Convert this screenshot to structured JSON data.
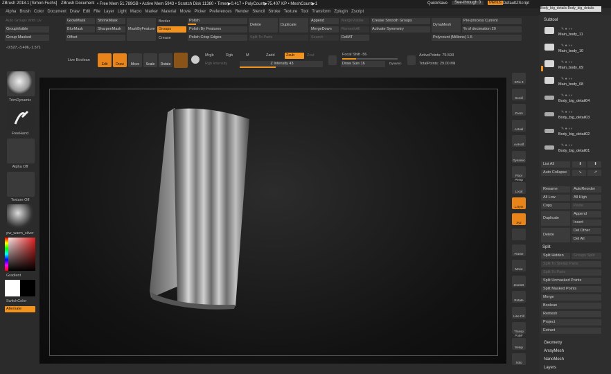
{
  "title": {
    "app": "ZBrush 2018.1 [Simon Fuchs]",
    "doc": "ZBrush Document",
    "stats": "• Free Mem 51.789GB • Active Mem 5943 • Scratch Disk 11380 • Timer▶0.417 • PolyCount▶75.407 KP • MeshCount▶1",
    "quicksave": "QuickSave",
    "seethrough": "See-through  0",
    "menus": "Menus",
    "script": "DefaultZScript"
  },
  "menu": [
    "Alpha",
    "Brush",
    "Color",
    "Document",
    "Draw",
    "Edit",
    "File",
    "Layer",
    "Light",
    "Macro",
    "Marker",
    "Material",
    "Movie",
    "Picker",
    "Preferences",
    "Render",
    "Stencil",
    "Stroke",
    "Texture",
    "Tool",
    "Transform",
    "Zplugin",
    "Zscript"
  ],
  "top_left": {
    "auto_groups": "Auto Groups With Uv",
    "group_visible": "GroupVisible",
    "group_masked": "Group Masked",
    "coords": "-0.527,-3.406,-1.571"
  },
  "masking": {
    "grow": "GrowMask",
    "shrink": "ShrinkMask",
    "blur": "BlurMask",
    "sharpen": "SharpenMask",
    "offset": "Offset",
    "mask_by_feature": "MaskByFeature"
  },
  "polish": {
    "border": "Border",
    "groups": "Groups",
    "crease": "Crease",
    "polish": "Polish",
    "by_features": "Polish By Features",
    "crisp": "Polish Crisp Edges"
  },
  "subtool_ops": {
    "delete": "Delete",
    "duplicate": "Duplicate",
    "append": "Append",
    "merge_down": "MergeDown",
    "merge_visible": "MergeVisible",
    "remesh": "RemeshAll",
    "split_to_parts": "Split To Parts",
    "search": "Search",
    "delmt": "DelMT",
    "crease_smooth": "Crease Smooth Groups",
    "activate_symmetry": "Activate Symmetry",
    "dynamesh": "DynaMesh",
    "preprocess": "Pre-process Current",
    "decimation": "% of decimation 20",
    "polycount_millions": "Polycount (Millions) 1.5"
  },
  "toolbar": {
    "live_boolean": "Live Boolean",
    "edit": "Edit",
    "draw": "Draw",
    "move": "Move",
    "scale": "Scale",
    "rotate": "Rotate",
    "mrgb": "Mrgb",
    "rgb": "Rgb",
    "m": "M",
    "zadd": "Zadd",
    "zsub": "Zsub",
    "zcut": "Zcut",
    "rgb_intensity": "Rgb Intensity",
    "z_intensity": "Z Intensity 43",
    "focal_shift": "Focal Shift -56",
    "draw_size": "Draw Size 16",
    "dynamic": "Dynamic",
    "active_points": "ActivePoints: 75.593",
    "total_points": "TotalPoints: 29.00 Mil"
  },
  "left_shelf": {
    "brush": "TrimDynamic",
    "stroke": "FreeHand",
    "alpha": "Alpha Off",
    "texture": "Texture Off",
    "material": "pw_warm_silver",
    "gradient": "Gradient",
    "switch_color": "SwitchColor",
    "alternate": "Alternate"
  },
  "right_shelf": [
    "SPix 3",
    "Scroll",
    "Zoom",
    "Actual",
    "AAHalf",
    "Dynamic Persp",
    "Floor",
    "Local",
    "L.Sym",
    "Xyz",
    "",
    "Frame",
    "Move",
    "ZoomD",
    "Rotate",
    "Line Fill PolyF",
    "Transp",
    "Setup",
    "Solo"
  ],
  "subtool": {
    "header": "Subtool",
    "tabs": "Body_big_details  Body_big_details",
    "items": [
      "Main_body_11",
      "Main_body_10",
      "Main_body_09",
      "Main_body_08",
      "Body_big_detail04",
      "Body_big_detail03",
      "Body_big_detail02",
      "Body_big_detail01"
    ]
  },
  "subtool_panel": {
    "list_all": "List All",
    "auto_collapse": "Auto Collapse",
    "rename": "Rename",
    "autoreorder": "AutoReorder",
    "all_low": "All Low",
    "all_high": "All High",
    "copy": "Copy",
    "paste": "Paste",
    "duplicate": "Duplicate",
    "append": "Append",
    "insert": "Insert",
    "delete": "Delete",
    "del_other": "Del Other",
    "del_all": "Del All",
    "split": "Split",
    "split_hidden": "Split Hidden",
    "groups_split": "Groups Split",
    "split_similar": "Split To Similar Parts",
    "split_parts": "Split To Parts",
    "split_unmasked": "Split Unmasked Points",
    "split_masked": "Split Masked Points",
    "merge": "Merge",
    "boolean": "Boolean",
    "remesh": "Remesh",
    "project": "Project",
    "extract": "Extract",
    "geometry": "Geometry",
    "arraymesh": "ArrayMesh",
    "nanomesh": "NanoMesh",
    "layers": "Layers"
  },
  "colors": {
    "accent": "#f29320",
    "bg": "#2b2b2b"
  }
}
